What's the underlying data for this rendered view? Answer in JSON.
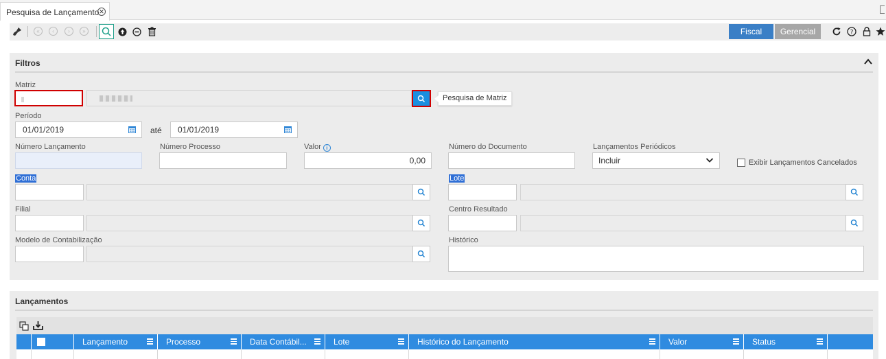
{
  "tab": {
    "title": "Pesquisa de Lançamento"
  },
  "toolbar": {
    "fiscal_label": "Fiscal",
    "gerencial_label": "Gerencial",
    "icons": [
      "broom-icon",
      "first-icon",
      "prev-icon",
      "next-icon",
      "last-icon",
      "search-icon",
      "upload-icon",
      "remove-icon",
      "trash-icon",
      "refresh-icon",
      "help-icon",
      "lock-icon",
      "star-icon"
    ]
  },
  "filtros": {
    "title": "Filtros",
    "matriz_label": "Matriz",
    "matriz_value": "",
    "matriz_tooltip": "Pesquisa de Matriz",
    "periodo_label": "Período",
    "periodo_inicio": "01/01/2019",
    "ate_label": "até",
    "periodo_fim": "01/01/2019",
    "numero_lancamento_label": "Número Lançamento",
    "numero_processo_label": "Número Processo",
    "valor_label": "Valor",
    "valor_value": "0,00",
    "numero_documento_label": "Número do Documento",
    "lancamentos_periodicos_label": "Lançamentos Periódicos",
    "lancamentos_periodicos_value": "Incluir",
    "exibir_cancelados_label": "Exibir Lançamentos Cancelados",
    "conta_label": "Conta",
    "lote_label": "Lote",
    "filial_label": "Filial",
    "centro_resultado_label": "Centro Resultado",
    "modelo_contabilizacao_label": "Modelo de Contabilização",
    "historico_label": "Histórico"
  },
  "lancamentos": {
    "title": "Lançamentos",
    "columns": [
      "Lançamento",
      "Processo",
      "Data Contábil...",
      "Lote",
      "Histórico do Lançamento",
      "Valor",
      "Status"
    ]
  },
  "colors": {
    "accent": "#2f8be0",
    "fiscal": "#3a7fc6",
    "gerencial": "#a7a7a7",
    "highlight": "#d00000"
  }
}
